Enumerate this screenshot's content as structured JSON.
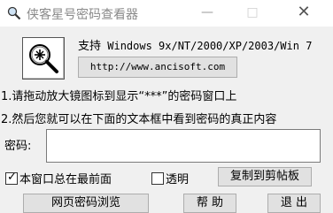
{
  "window": {
    "title": "侠客星号密码查看器",
    "minimize_glyph": "—",
    "maximize_glyph": "□",
    "close_glyph": "✕"
  },
  "header": {
    "support_cn": "支持",
    "support_os": " Windows 9x/NT/2000/XP/2003/Win 7",
    "url_button": "http://www.ancisoft.com"
  },
  "instructions": {
    "step1": "1.请拖动放大镜图标到显示“***”的密码窗口上",
    "step2": "2.然后您就可以在下面的文本框中看到密码的真正内容"
  },
  "password": {
    "label": "密码:",
    "value": ""
  },
  "options": {
    "always_on_top_label": "本窗口总在最前面",
    "always_on_top_checked": true,
    "transparent_label": "透明",
    "transparent_checked": false,
    "check_glyph": "✓"
  },
  "buttons": {
    "copy": "复制到剪帖板",
    "web": "网页密码浏览",
    "help": "帮 助",
    "exit": "退 出"
  },
  "icons": {
    "app": "magnifier-key-icon",
    "drag_target": "magnifier-star-icon"
  }
}
